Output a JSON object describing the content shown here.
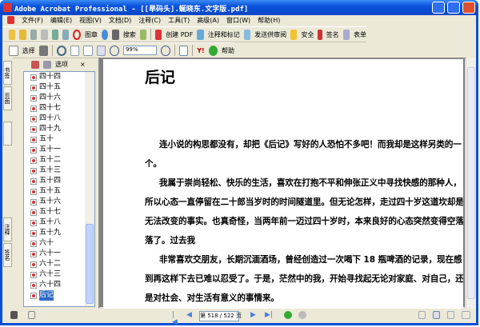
{
  "window": {
    "title": "Adobe Acrobat Professional - [[旱码头].蜒晓东.文字版.pdf]"
  },
  "menu": [
    "文件(F)",
    "编辑(E)",
    "视图(V)",
    "文档(D)",
    "注释(C)",
    "工具(T)",
    "高级(A)",
    "窗口(W)",
    "帮助(H)"
  ],
  "toolbar1": {
    "stamp": "图章",
    "search": "搜索",
    "create_pdf": "创建 PDF",
    "comment": "注释和标记",
    "review": "发送供审阅",
    "secure": "安全",
    "sign": "签名",
    "forms": "表单"
  },
  "toolbar2": {
    "select": "选择",
    "zoom_value": "99%",
    "help": "帮助"
  },
  "sidebar": {
    "tabs": [
      "书签",
      "页面",
      "",
      "注释",
      "签名"
    ],
    "options": "选项",
    "close": "×",
    "bookmarks": [
      "四十四",
      "四十五",
      "四十六",
      "四十七",
      "四十八",
      "四十九",
      "五十",
      "五十一",
      "五十二",
      "五十三",
      "五十四",
      "五十五",
      "五十六",
      "五十七",
      "五十八",
      "五十九",
      "六十",
      "六十一",
      "六十二",
      "六十三",
      "六十四",
      "后记"
    ],
    "selected": "后记"
  },
  "document": {
    "heading": "后记",
    "lines": [
      {
        "text": "连小说的构思都没有，却把《后记》写好的人恐怕不多吧！而我却是这样另类的一",
        "indent": true
      },
      {
        "text": "个。",
        "indent": false
      },
      {
        "text": "我属于崇尚轻松、快乐的生活，喜欢在打抱不平和伸张正义中寻找快感的那种人，",
        "indent": true
      },
      {
        "text": "所以心态一直停留在二十郎当岁时的时间隧道里。但无论怎样，走过四十岁这道坎却是",
        "indent": false
      },
      {
        "text": "无法改变的事实。也真奇怪，当两年前一迈过四十岁时，本来良好的心态突然变得空落",
        "indent": false
      },
      {
        "text": "落了。过去我",
        "indent": false
      },
      {
        "text": "非常喜欢交朋友，长期沉湎酒场，曾经创造过一次喝下 18 瓶啤酒的记录，现在感",
        "indent": true
      },
      {
        "text": "到再这样下去已难以忍受了。于是，茫然中的我，开始寻找起无论对家庭、对自己，还",
        "indent": false
      },
      {
        "text": "是对社会、对生活有意义的事情来。",
        "indent": false
      }
    ]
  },
  "status": {
    "page_indicator": "第 518 / 522 页",
    "current_page": 518,
    "total_pages": 522
  }
}
